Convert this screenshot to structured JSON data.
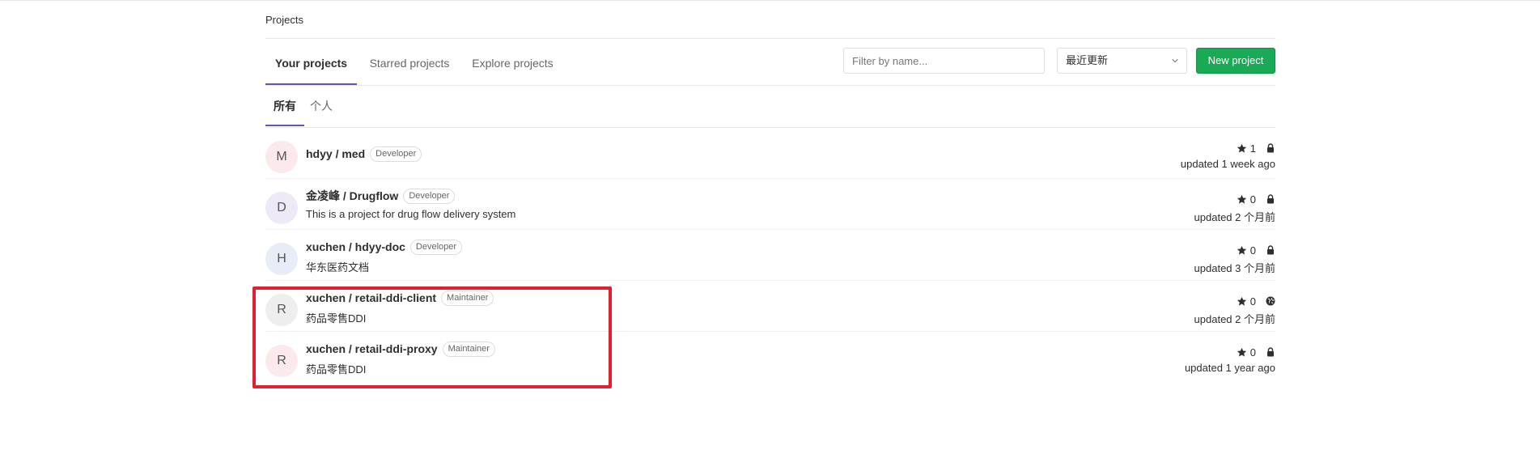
{
  "breadcrumb": "Projects",
  "tabs": [
    {
      "label": "Your projects",
      "active": true
    },
    {
      "label": "Starred projects",
      "active": false
    },
    {
      "label": "Explore projects",
      "active": false
    }
  ],
  "filter": {
    "placeholder": "Filter by name...",
    "value": ""
  },
  "sort": {
    "selected": "最近更新",
    "icon": "chevron-down-icon"
  },
  "new_project_label": "New project",
  "subtabs": [
    {
      "label": "所有",
      "active": true
    },
    {
      "label": "个人",
      "active": false
    }
  ],
  "projects": [
    {
      "initial": "M",
      "avatar_color": "#fbe9eb",
      "name": "hdyy / med",
      "role": "Developer",
      "description": "",
      "stars": "1",
      "visibility": "lock-icon",
      "updated": "updated 1 week ago"
    },
    {
      "initial": "D",
      "avatar_color": "#eee9f6",
      "name": "金凌峰 / Drugflow",
      "role": "Developer",
      "description": "This is a project for drug flow delivery system",
      "stars": "0",
      "visibility": "lock-icon",
      "updated": "updated 2 个月前"
    },
    {
      "initial": "H",
      "avatar_color": "#e8ecf7",
      "name": "xuchen / hdyy-doc",
      "role": "Developer",
      "description": "华东医药文档",
      "stars": "0",
      "visibility": "lock-icon",
      "updated": "updated 3 个月前"
    },
    {
      "initial": "R",
      "avatar_color": "#eeeeee",
      "name": "xuchen / retail-ddi-client",
      "role": "Maintainer",
      "description": "药品零售DDI",
      "stars": "0",
      "visibility": "globe-icon",
      "updated": "updated 2 个月前"
    },
    {
      "initial": "R",
      "avatar_color": "#fbe9eb",
      "name": "xuchen / retail-ddi-proxy",
      "role": "Maintainer",
      "description": "药品零售DDI",
      "stars": "0",
      "visibility": "lock-icon",
      "updated": "updated 1 year ago"
    }
  ],
  "colors": {
    "accent": "#6b4fbb",
    "new_button": "#1aaa55",
    "highlight_box": "#e3202f"
  }
}
